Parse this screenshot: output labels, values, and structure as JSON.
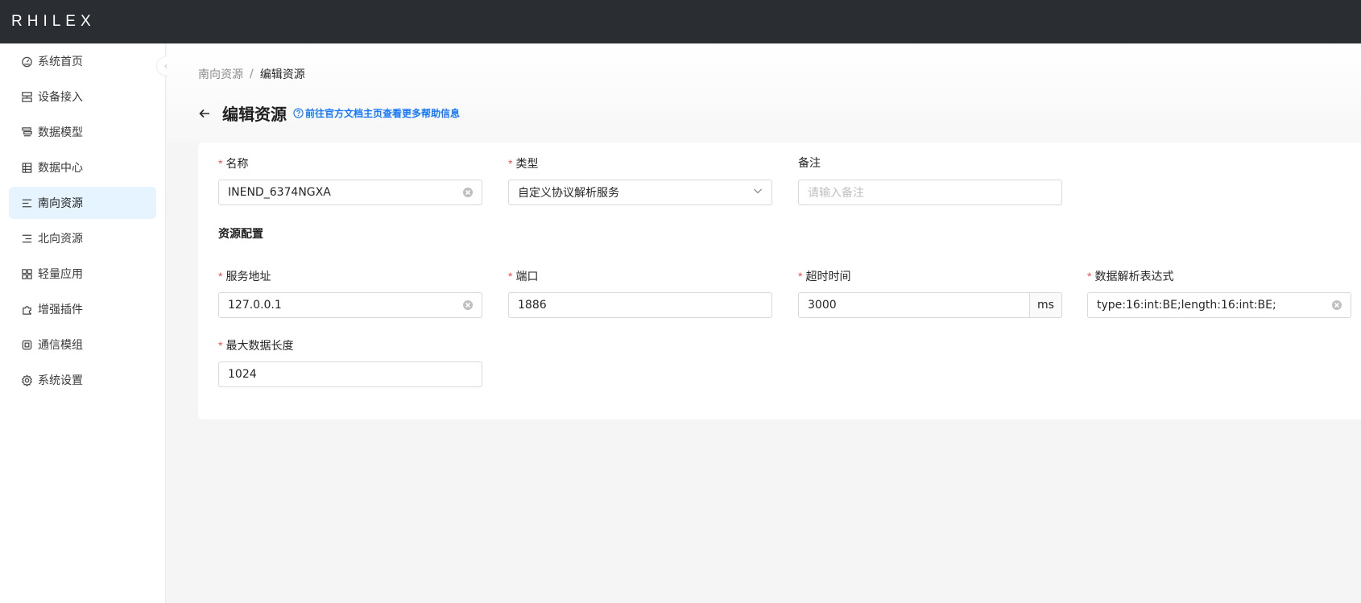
{
  "app": {
    "logo": "RHILEX"
  },
  "sidebar": {
    "items": [
      {
        "label": "系统首页",
        "icon": "dashboard-icon",
        "active": false
      },
      {
        "label": "设备接入",
        "icon": "device-icon",
        "active": false
      },
      {
        "label": "数据模型",
        "icon": "data-model-icon",
        "active": false
      },
      {
        "label": "数据中心",
        "icon": "data-center-icon",
        "active": false
      },
      {
        "label": "南向资源",
        "icon": "south-resource-icon",
        "active": true
      },
      {
        "label": "北向资源",
        "icon": "north-resource-icon",
        "active": false
      },
      {
        "label": "轻量应用",
        "icon": "app-icon",
        "active": false
      },
      {
        "label": "增强插件",
        "icon": "plugin-icon",
        "active": false
      },
      {
        "label": "通信模组",
        "icon": "module-icon",
        "active": false
      },
      {
        "label": "系统设置",
        "icon": "settings-icon",
        "active": false
      }
    ]
  },
  "breadcrumb": {
    "parent": "南向资源",
    "separator": "/",
    "current": "编辑资源"
  },
  "page": {
    "title": "编辑资源",
    "help_link": "前往官方文档主页查看更多帮助信息"
  },
  "form": {
    "name": {
      "label": "名称",
      "value": "INEND_6374NGXA",
      "required": true
    },
    "type": {
      "label": "类型",
      "value": "自定义协议解析服务",
      "required": true
    },
    "remark": {
      "label": "备注",
      "value": "",
      "placeholder": "请输入备注",
      "required": false
    },
    "section_title": "资源配置",
    "host": {
      "label": "服务地址",
      "value": "127.0.0.1",
      "required": true
    },
    "port": {
      "label": "端口",
      "value": "1886",
      "required": true
    },
    "timeout": {
      "label": "超时时间",
      "value": "3000",
      "unit": "ms",
      "required": true
    },
    "expression": {
      "label": "数据解析表达式",
      "value": "type:16:int:BE;length:16:int:BE;",
      "required": true
    },
    "max_length": {
      "label": "最大数据长度",
      "value": "1024",
      "required": true
    }
  },
  "colors": {
    "topbar": "#2a2d31",
    "accent": "#1677ff",
    "active_bg": "#e6f4ff",
    "required": "#ff4d4f"
  }
}
